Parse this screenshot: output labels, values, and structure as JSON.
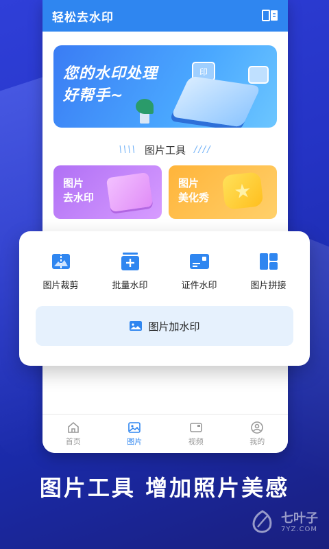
{
  "app": {
    "title": "轻松去水印"
  },
  "banner": {
    "line1": "您的水印处理",
    "line2": "好帮手~",
    "badge": "印"
  },
  "section": {
    "title": "图片工具",
    "left_deco": "\\\\\\\\",
    "right_deco": "////"
  },
  "tiles": [
    {
      "line1": "图片",
      "line2": "去水印"
    },
    {
      "line1": "图片",
      "line2": "美化秀"
    }
  ],
  "tools": [
    {
      "label": "图片裁剪",
      "icon": "crop-icon"
    },
    {
      "label": "批量水印",
      "icon": "batch-watermark-icon"
    },
    {
      "label": "证件水印",
      "icon": "id-card-icon"
    },
    {
      "label": "图片拼接",
      "icon": "collage-icon"
    }
  ],
  "add_watermark": {
    "label": "图片加水印",
    "icon": "image-icon"
  },
  "tabbar": [
    {
      "label": "首页",
      "icon": "home-icon",
      "active": false
    },
    {
      "label": "图片",
      "icon": "image-icon",
      "active": true
    },
    {
      "label": "视频",
      "icon": "video-icon",
      "active": false
    },
    {
      "label": "我的",
      "icon": "user-icon",
      "active": false
    }
  ],
  "slogan": "图片工具 增加照片美感",
  "watermark_logo": {
    "brand": "七叶子",
    "domain": "7YZ.COM"
  },
  "colors": {
    "primary": "#2f86f0",
    "bg_blue": "#2433c4",
    "tile_purple": "#b070f5",
    "tile_orange": "#ffb43a"
  }
}
